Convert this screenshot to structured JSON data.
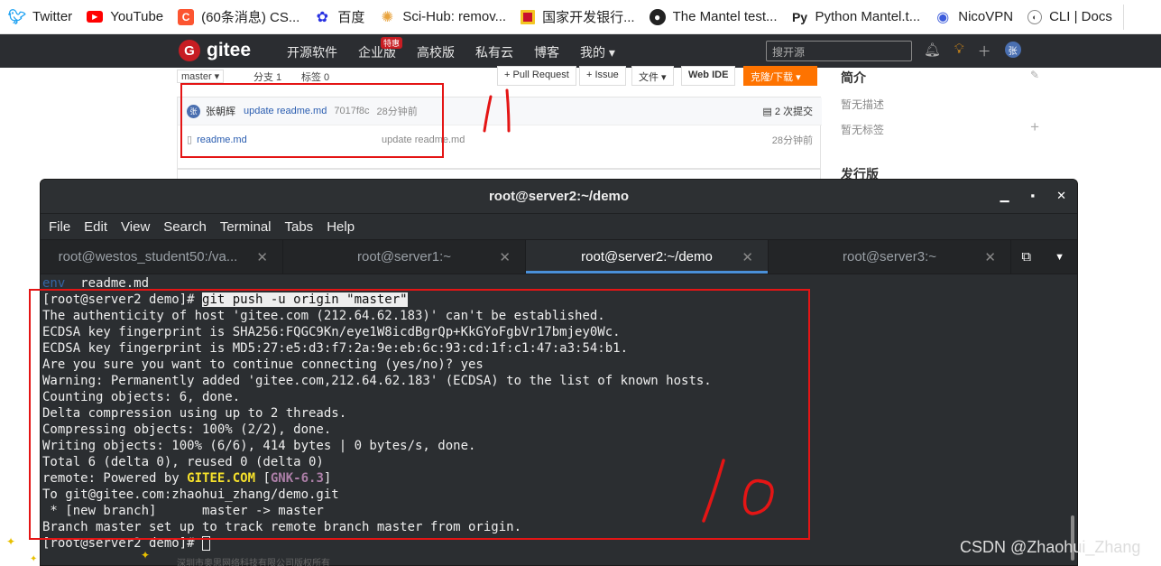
{
  "bookmarks": [
    {
      "label": "Twitter",
      "icon": "twitter-icon",
      "color": "#1da1f2"
    },
    {
      "label": "YouTube",
      "icon": "youtube-icon",
      "color": "#ff0000"
    },
    {
      "label": "(60条消息) CS...",
      "icon": "csdn-icon",
      "color": "#fc5531"
    },
    {
      "label": "百度",
      "icon": "baidu-icon",
      "color": "#2932e1"
    },
    {
      "label": "Sci-Hub: remov...",
      "icon": "scihub-icon",
      "color": "#e8a33d"
    },
    {
      "label": "国家开发银行...",
      "icon": "cdb-icon",
      "color": "#c8102e"
    },
    {
      "label": "The Mantel test...",
      "icon": "github-icon",
      "color": "#222222"
    },
    {
      "label": "Python Mantel.t...",
      "icon": "python-icon",
      "color": "#222222"
    },
    {
      "label": "NicoVPN",
      "icon": "vpn-icon",
      "color": "#3b5bdb"
    },
    {
      "label": "CLI | Docs",
      "icon": "docs-icon",
      "color": "#444444"
    }
  ],
  "gitee": {
    "brand": "gitee",
    "logo_letter": "G",
    "menu": [
      "开源软件",
      "企业版",
      "高校版",
      "私有云",
      "博客",
      "我的 ▾"
    ],
    "badge": "特惠",
    "search_placeholder": "搜开源",
    "avatar_letter": "张"
  },
  "repo": {
    "branch": "master ▾",
    "branches": "分支 1",
    "tags": "标签 0",
    "pull_request": "+ Pull Request",
    "issue": "+ Issue",
    "file": "文件 ▾",
    "webide": "Web IDE",
    "clone": "克隆/下载 ▾",
    "commit_author": "张朝辉",
    "commit_msg": "update readme.md",
    "commit_hash": "7017f8c",
    "commit_time": "28分钟前",
    "commit_count": "2 次提交",
    "file_name": "readme.md",
    "file_msg": "update readme.md",
    "file_time": "28分钟前"
  },
  "side": {
    "intro_title": "简介",
    "no_desc": "暂无描述",
    "no_tags": "暂无标签",
    "release_title": "发行版"
  },
  "terminal": {
    "title": "root@server2:~/demo",
    "menu": [
      "File",
      "Edit",
      "View",
      "Search",
      "Terminal",
      "Tabs",
      "Help"
    ],
    "tabs": [
      {
        "label": "root@westos_student50:/va...",
        "active": false
      },
      {
        "label": "root@server1:~",
        "active": false
      },
      {
        "label": "root@server2:~/demo",
        "active": true
      },
      {
        "label": "root@server3:~",
        "active": false
      }
    ],
    "line0_blue": "env",
    "line0_rest": "  readme.md",
    "prompt": "[root@server2 demo]# ",
    "command": "git push -u origin \"master\"",
    "lines": [
      "The authenticity of host 'gitee.com (212.64.62.183)' can't be established.",
      "ECDSA key fingerprint is SHA256:FQGC9Kn/eye1W8icdBgrQp+KkGYoFgbVr17bmjey0Wc.",
      "ECDSA key fingerprint is MD5:27:e5:d3:f7:2a:9e:eb:6c:93:cd:1f:c1:47:a3:54:b1.",
      "Are you sure you want to continue connecting (yes/no)? yes",
      "Warning: Permanently added 'gitee.com,212.64.62.183' (ECDSA) to the list of known hosts.",
      "Counting objects: 6, done.",
      "Delta compression using up to 2 threads.",
      "Compressing objects: 100% (2/2), done.",
      "Writing objects: 100% (6/6), 414 bytes | 0 bytes/s, done.",
      "Total 6 (delta 0), reused 0 (delta 0)"
    ],
    "remote_prefix": "remote: Powered by ",
    "remote_gitee": "GITEE.COM",
    "remote_mid": " [",
    "remote_gnk": "GNK-6.3",
    "remote_end": "]",
    "lines2": [
      "To git@gitee.com:zhaohui_zhang/demo.git",
      " * [new branch]      master -> master",
      "Branch master set up to track remote branch master from origin."
    ],
    "final_prompt": "[root@server2 demo]# "
  },
  "footer": "深圳市奥思网络科技有限公司版权所有",
  "watermark": "CSDN @Zhaohui_Zhang",
  "annotation_colors": {
    "red": "#e41515"
  }
}
